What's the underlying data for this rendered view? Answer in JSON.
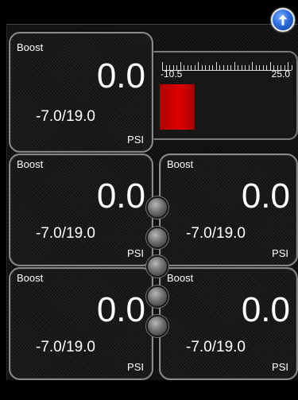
{
  "bar_gauge": {
    "scale_min": "-10.5",
    "scale_max": "25.0",
    "fill_color": "#d00000"
  },
  "gauges": [
    {
      "label": "Boost",
      "value": "0.0",
      "range": "-7.0/19.0",
      "unit": "PSI"
    },
    {
      "label": "Boost",
      "value": "0.0",
      "range": "-7.0/19.0",
      "unit": "PSI"
    },
    {
      "label": "Boost",
      "value": "0.0",
      "range": "-7.0/19.0",
      "unit": "PSI"
    },
    {
      "label": "Boost",
      "value": "0.0",
      "range": "-7.0/19.0",
      "unit": "PSI"
    },
    {
      "label": "Boost",
      "value": "0.0",
      "range": "-7.0/19.0",
      "unit": "PSI"
    }
  ],
  "controls": {
    "up_icon": "arrow-up-icon",
    "knob_count": 5,
    "accent_color": "#2d6de0"
  }
}
